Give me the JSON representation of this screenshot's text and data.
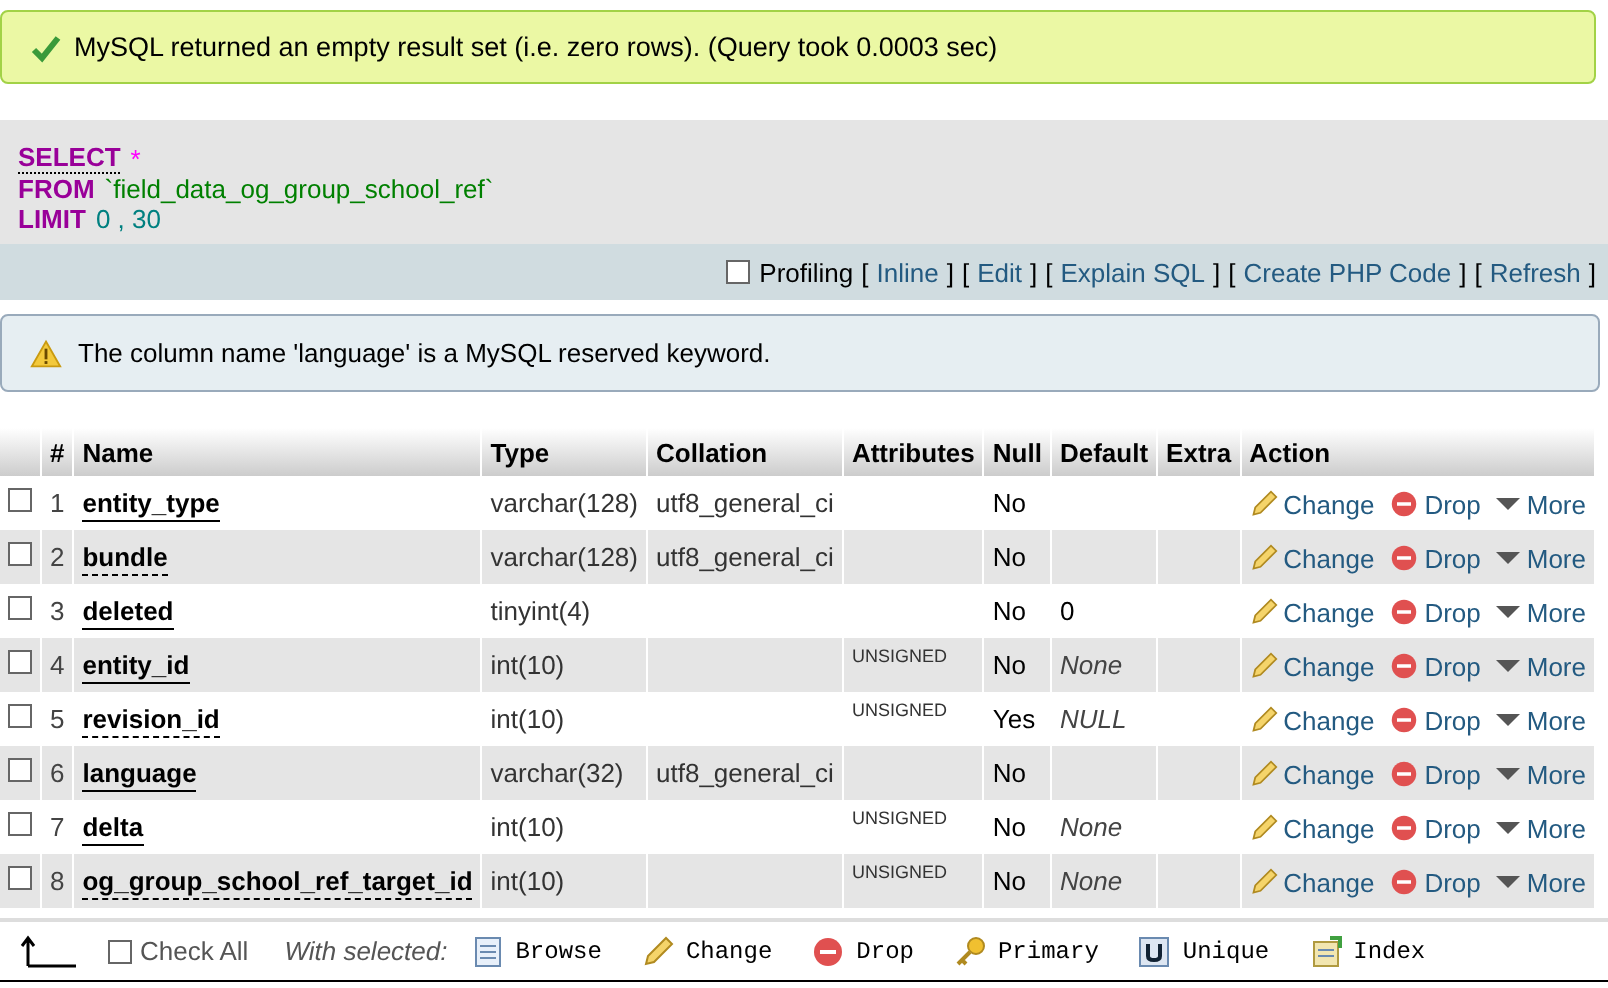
{
  "success_message": "MySQL returned an empty result set (i.e. zero rows). (Query took 0.0003 sec)",
  "sql": {
    "lines": [
      {
        "tokens": [
          {
            "kind": "keyword",
            "text": "SELECT"
          },
          {
            "kind": "symbol",
            "text": "*"
          }
        ]
      },
      {
        "tokens": [
          {
            "kind": "keyword",
            "text": "FROM"
          },
          {
            "kind": "identifier",
            "text": "`field_data_og_group_school_ref`"
          }
        ]
      },
      {
        "tokens": [
          {
            "kind": "keyword",
            "text": "LIMIT"
          },
          {
            "kind": "number",
            "text": "0 , 30"
          }
        ]
      }
    ]
  },
  "query_links": {
    "profiling": {
      "label": "Profiling",
      "checked": false
    },
    "links": [
      {
        "open": "[",
        "label": "Inline",
        "close": "]"
      },
      {
        "open": "[",
        "label": "Edit",
        "close": "]"
      },
      {
        "open": "[",
        "label": "Explain SQL",
        "close": "]"
      },
      {
        "open": "[",
        "label": "Create PHP Code",
        "close": "]"
      },
      {
        "open": "[",
        "label": "Refresh",
        "close": "]"
      }
    ]
  },
  "warning": "The column name 'language' is a MySQL reserved keyword.",
  "table": {
    "columns": [
      "#",
      "Name",
      "Type",
      "Collation",
      "Attributes",
      "Null",
      "Default",
      "Extra",
      "Action"
    ],
    "rows": [
      {
        "checked": false,
        "index": "1",
        "name": "entity_type",
        "has_comment": false,
        "type": "varchar(128)",
        "collation": "utf8_general_ci",
        "null": "No",
        "actions": [
          "Change",
          "Drop",
          "More"
        ]
      },
      {
        "checked": false,
        "index": "2",
        "name": "bundle",
        "has_comment": true,
        "type": "varchar(128)",
        "collation": "utf8_general_ci",
        "null": "No",
        "actions": [
          "Change",
          "Drop",
          "More"
        ]
      },
      {
        "checked": false,
        "index": "3",
        "name": "deleted",
        "has_comment": false,
        "type": "tinyint(4)",
        "null": "No",
        "default": {
          "kind": "value",
          "text": "0"
        },
        "actions": [
          "Change",
          "Drop",
          "More"
        ]
      },
      {
        "checked": false,
        "index": "4",
        "name": "entity_id",
        "has_comment": false,
        "type": "int(10)",
        "attributes": "UNSIGNED",
        "null": "No",
        "default": {
          "kind": "keyword",
          "text": "None"
        },
        "actions": [
          "Change",
          "Drop",
          "More"
        ]
      },
      {
        "checked": false,
        "index": "5",
        "name": "revision_id",
        "has_comment": true,
        "type": "int(10)",
        "attributes": "UNSIGNED",
        "null": "Yes",
        "default": {
          "kind": "keyword",
          "text": "NULL"
        },
        "actions": [
          "Change",
          "Drop",
          "More"
        ]
      },
      {
        "checked": false,
        "index": "6",
        "name": "language",
        "has_comment": false,
        "type": "varchar(32)",
        "collation": "utf8_general_ci",
        "null": "No",
        "actions": [
          "Change",
          "Drop",
          "More"
        ]
      },
      {
        "checked": false,
        "index": "7",
        "name": "delta",
        "has_comment": false,
        "type": "int(10)",
        "attributes": "UNSIGNED",
        "null": "No",
        "default": {
          "kind": "keyword",
          "text": "None"
        },
        "actions": [
          "Change",
          "Drop",
          "More"
        ]
      },
      {
        "checked": false,
        "index": "8",
        "name": "og_group_school_ref_target_id",
        "has_comment": true,
        "type": "int(10)",
        "attributes": "UNSIGNED",
        "null": "No",
        "default": {
          "kind": "keyword",
          "text": "None"
        },
        "actions": [
          "Change",
          "Drop",
          "More"
        ]
      }
    ]
  },
  "footer": {
    "check_all": {
      "label": "Check All",
      "checked": false
    },
    "with_selected": "With selected:",
    "actions": [
      {
        "kind": "browse",
        "label": "Browse"
      },
      {
        "kind": "change",
        "label": "Change"
      },
      {
        "kind": "drop",
        "label": "Drop"
      },
      {
        "kind": "primary",
        "label": "Primary"
      },
      {
        "kind": "unique",
        "label": "Unique"
      },
      {
        "kind": "index",
        "label": "Index"
      }
    ]
  }
}
